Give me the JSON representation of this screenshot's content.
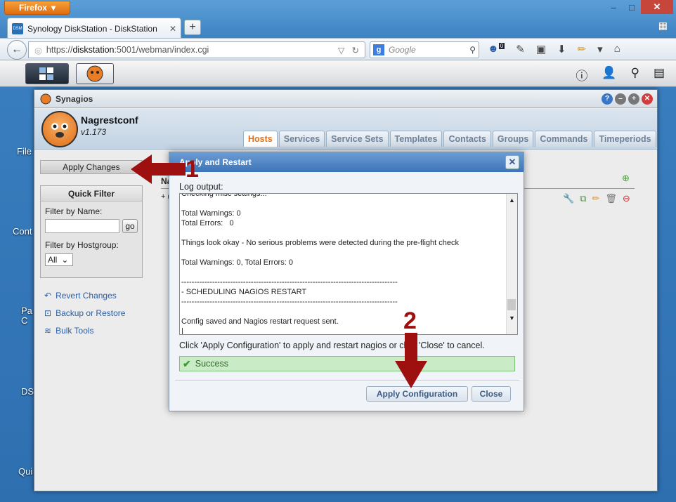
{
  "browser": {
    "menu_label": "Firefox",
    "tab_title": "Synology DiskStation - DiskStation",
    "tab_favicon": "DSM",
    "url_prefix": "https://",
    "url_host": "diskstation",
    "url_rest": ":5001/webman/index.cgi",
    "search_placeholder": "Google",
    "notification_count": "0"
  },
  "desktop": {
    "icons": [
      "File",
      "Cont",
      "Pa C",
      "DS",
      "Qui"
    ]
  },
  "app": {
    "window_title": "Synagios",
    "name": "Nagrestconf",
    "version": "v1.173",
    "tabs": [
      "Hosts",
      "Services",
      "Service Sets",
      "Templates",
      "Contacts",
      "Groups",
      "Commands",
      "Timeperiods"
    ],
    "active_tab": "Hosts",
    "column_header": "Na",
    "row_prefix": "+ (",
    "sidebar": {
      "apply_changes": "Apply Changes",
      "quick_filter_title": "Quick Filter",
      "filter_by_name_label": "Filter by Name:",
      "go_label": "go",
      "filter_by_hostgroup_label": "Filter by Hostgroup:",
      "hostgroup_value": "All",
      "links": [
        {
          "icon": "revert-icon",
          "label": "Revert Changes"
        },
        {
          "icon": "backup-icon",
          "label": "Backup or Restore"
        },
        {
          "icon": "layers-icon",
          "label": "Bulk Tools"
        }
      ]
    }
  },
  "dialog": {
    "title": "Apply and Restart",
    "log_label": "Log output:",
    "log_lines": [
      "Checking misc settings...",
      "",
      "Total Warnings: 0",
      "Total Errors:   0",
      "",
      "Things look okay - No serious problems were detected during the pre-flight check",
      "",
      "Total Warnings: 0, Total Errors: 0",
      "",
      "------------------------------------------------------------------------------------",
      "- SCHEDULING NAGIOS RESTART",
      "------------------------------------------------------------------------------------",
      "",
      "Config saved and Nagios restart request sent.",
      "|"
    ],
    "instruction": "Click 'Apply Configuration' to apply and restart nagios or click 'Close' to cancel.",
    "status": "Success",
    "apply_button": "Apply Configuration",
    "close_button": "Close"
  },
  "annotations": {
    "step1": "1",
    "step2": "2",
    "arrow_color": "#9e0f0f"
  }
}
